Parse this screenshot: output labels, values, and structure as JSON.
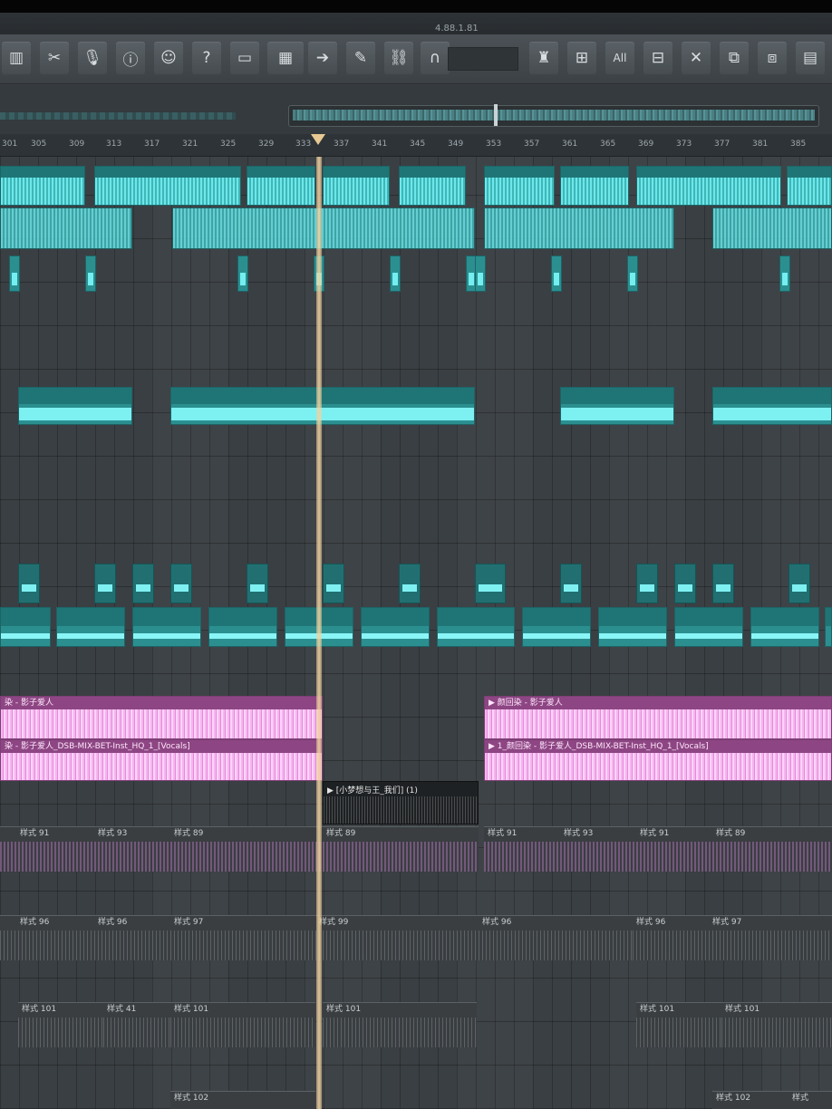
{
  "menu": {
    "items": [
      "",
      "",
      "4.88.1.81"
    ]
  },
  "toolbar": {
    "buttons": [
      {
        "icon": "plugin-icon",
        "glyph": "▥"
      },
      {
        "icon": "scissors-icon",
        "glyph": "✂"
      },
      {
        "icon": "microphone-icon",
        "glyph": "🎙"
      },
      {
        "icon": "info-icon",
        "glyph": "ⓘ"
      },
      {
        "icon": "feedback-icon",
        "glyph": "☺"
      },
      {
        "icon": "help-icon",
        "glyph": "?"
      },
      {
        "icon": "window-icon",
        "glyph": "▭"
      },
      {
        "icon": "piano-icon",
        "glyph": "▦"
      },
      {
        "icon": "arrow-right-icon",
        "glyph": "➔"
      },
      {
        "icon": "pencil-icon",
        "glyph": "✎"
      },
      {
        "icon": "link-icon",
        "glyph": "⛓"
      },
      {
        "icon": "magnet-icon",
        "glyph": "∩"
      }
    ],
    "snap_value": "",
    "right_buttons": [
      {
        "icon": "stamp-icon",
        "glyph": "♜"
      },
      {
        "icon": "quantize-icon",
        "glyph": "⊞"
      },
      {
        "icon": "all-icon",
        "glyph": "All"
      },
      {
        "icon": "select-icon",
        "glyph": "⊟"
      },
      {
        "icon": "close-icon",
        "glyph": "✕"
      },
      {
        "icon": "paste-icon",
        "glyph": "⧉"
      },
      {
        "icon": "copy-icon",
        "glyph": "⧈"
      },
      {
        "icon": "grid-icon",
        "glyph": "▤"
      }
    ]
  },
  "ruler": {
    "bars": [
      "301",
      "305",
      "309",
      "313",
      "317",
      "321",
      "325",
      "329",
      "333",
      "337",
      "341",
      "345",
      "349",
      "353",
      "357",
      "361",
      "365",
      "369",
      "373",
      "377",
      "381",
      "385"
    ]
  },
  "tracks": {
    "vocal_clip_1": "染 - 影子爱人",
    "vocal_clip_2": "染 - 影子爱人_DSB-MIX-BET-Inst_HQ_1_[Vocals]",
    "vocal_clip_3": "▶ 颜回染 - 影子爱人",
    "vocal_clip_4": "▶ 1_颜回染 - 影子爱人_DSB-MIX-BET-Inst_HQ_1_[Vocals]",
    "dark_clip": "▶ [小梦想与王_我们] (1)",
    "pattern_labels": {
      "row1": [
        "样式 91",
        "样式 93",
        "样式 89",
        "样式 89",
        "样式 91",
        "样式 93",
        "样式 91",
        "样式 89"
      ],
      "row2": [
        "样式 96",
        "样式 96",
        "样式 97",
        "样式 99",
        "样式 96",
        "样式 96",
        "样式 97"
      ],
      "row3": [
        "样式 101",
        "样式 41",
        "样式 101",
        "样式 101",
        "样式 101",
        "样式 101"
      ],
      "row4": [
        "样式 102",
        "样式 102",
        "样式"
      ]
    }
  },
  "colors": {
    "accent": "#2b8f90",
    "vocal": "#b06aa6",
    "playhead": "#e8c893"
  }
}
